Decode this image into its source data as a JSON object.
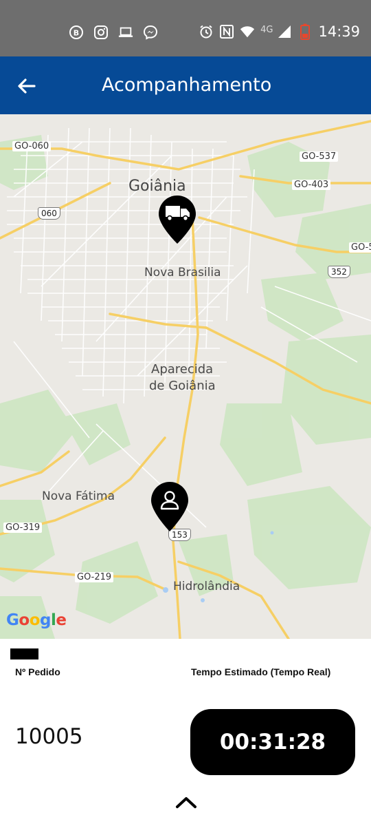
{
  "status_bar": {
    "network": "4G",
    "time": "14:39",
    "left_icons": [
      "b-icon",
      "instagram-icon",
      "laptop-icon",
      "messenger-icon"
    ],
    "right_icons": [
      "alarm-icon",
      "nfc-icon",
      "wifi-icon",
      "signal-icon",
      "battery-icon"
    ]
  },
  "app_bar": {
    "title": "Acompanhamento",
    "back_icon": "arrow-left-icon",
    "background": "#064a96"
  },
  "map": {
    "places": {
      "goiania": "Goiânia",
      "nova_brasilia": "Nova Brasilia",
      "aparecida_1": "Aparecida",
      "aparecida_2": "de Goiânia",
      "nova_fatima": "Nova Fátima",
      "hidrolandia": "Hidrolândia"
    },
    "roads": {
      "go060": "GO-060",
      "go537": "GO-537",
      "go403": "GO-403",
      "go5": "GO-5",
      "r060": "060",
      "r352": "352",
      "go319": "GO-319",
      "go219": "GO-219",
      "r153": "153"
    },
    "attribution": "Google",
    "markers": [
      "truck-marker",
      "customer-marker"
    ]
  },
  "order_info": {
    "order_label": "Nº Pedido",
    "time_label": "Tempo Estimado (Tempo Real)",
    "order_number": "10005",
    "timer": "00:31:28"
  }
}
